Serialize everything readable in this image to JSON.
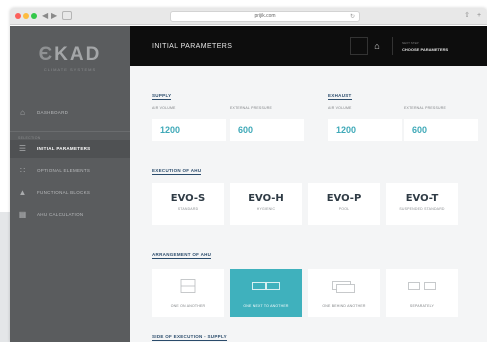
{
  "browser": {
    "url": "prijik.com"
  },
  "sidebar": {
    "logo_main": "KAD",
    "logo_sub": "CLIMATE SYSTEMS",
    "sub_heading": "SELECTION",
    "items": [
      {
        "label": "DASHBOARD",
        "icon": "home-icon"
      },
      {
        "label": "INITIAL PARAMETERS",
        "icon": "parameters-icon"
      },
      {
        "label": "OPTIONAL ELEMENTS",
        "icon": "elements-icon"
      },
      {
        "label": "FUNCTIONAL BLOCKS",
        "icon": "blocks-icon"
      },
      {
        "label": "AHU CALCULATION",
        "icon": "calculation-icon"
      }
    ]
  },
  "header": {
    "title": "INITIAL PARAMETERS",
    "small_label": "NEXT STEP",
    "action_label": "CHOOSE PARAMETERS"
  },
  "supply": {
    "title": "SUPPLY",
    "air_volume_label": "AIR VOLUME",
    "air_volume": "1200",
    "pressure_label": "EXTERNAL PRESSURE",
    "pressure": "600"
  },
  "exhaust": {
    "title": "EXHAUST",
    "air_volume_label": "AIR VOLUME",
    "air_volume": "1200",
    "pressure_label": "EXTERNAL PRESSURE",
    "pressure": "600"
  },
  "execution": {
    "title": "EXECUTION OF AHU",
    "cards": [
      {
        "name": "EVO-S",
        "sub": "STANDARD"
      },
      {
        "name": "EVO-H",
        "sub": "HYGIENIC"
      },
      {
        "name": "EVO-P",
        "sub": "POOL"
      },
      {
        "name": "EVO-T",
        "sub": "SUSPENDED STANDARD"
      }
    ]
  },
  "arrangement": {
    "title": "ARRANGEMENT OF AHU",
    "cards": [
      {
        "label": "ONE ON ANOTHER",
        "selected": false
      },
      {
        "label": "ONE NEXT TO ANOTHER",
        "selected": true
      },
      {
        "label": "ONE BEHIND ANOTHER",
        "selected": false
      },
      {
        "label": "SEPARATELY",
        "selected": false
      }
    ]
  },
  "supply_side": {
    "title": "SIDE OF EXECUTION - SUPPLY"
  },
  "colors": {
    "accent": "#3fb1bd",
    "sidebar": "#5a5c5e",
    "header": "#0d0d0d",
    "section_title": "#2a4b6b"
  }
}
